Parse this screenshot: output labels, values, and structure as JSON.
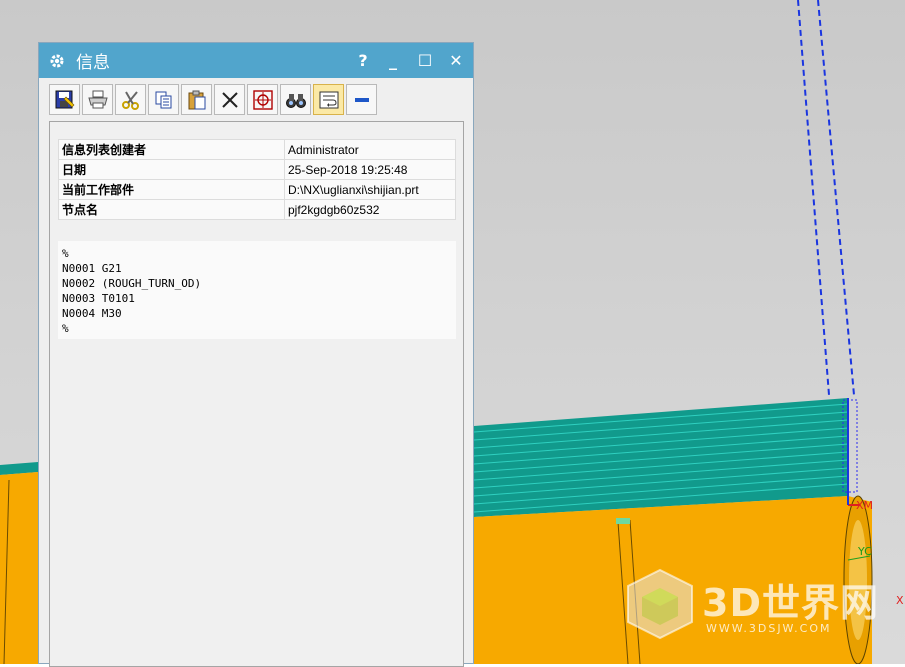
{
  "dialog": {
    "title": "信息",
    "help_label": "?",
    "minimize_label": "_",
    "maximize_label": "☐",
    "close_label": "✕"
  },
  "toolbar": {
    "tools": [
      {
        "icon": "save-icon"
      },
      {
        "icon": "print-icon"
      },
      {
        "icon": "cut-icon"
      },
      {
        "icon": "copy-icon"
      },
      {
        "icon": "paste-icon"
      },
      {
        "icon": "delete-icon"
      },
      {
        "icon": "target-icon"
      },
      {
        "icon": "binoculars-icon"
      },
      {
        "icon": "wrap-text-icon",
        "active": true
      },
      {
        "icon": "minimize-icon"
      }
    ]
  },
  "info": {
    "rows": [
      {
        "key": "信息列表创建者",
        "value": "Administrator"
      },
      {
        "key": "日期",
        "value": "25-Sep-2018 19:25:48"
      },
      {
        "key": "当前工作部件",
        "value": "D:\\NX\\uglianxi\\shijian.prt"
      },
      {
        "key": "节点名",
        "value": "pjf2kgdgb60z532"
      }
    ],
    "code_lines": [
      "%",
      "N0001 G21",
      "N0002 (ROUGH_TURN_OD)",
      "N0003 T0101",
      "N0004 M30",
      "%"
    ]
  },
  "viewport": {
    "axis_labels": {
      "xm": "XM",
      "yc": "YC",
      "x": "X"
    },
    "watermark_text": "3D世界网",
    "watermark_url": "WWW.3DSJW.COM"
  },
  "colors": {
    "titlebar": "#51a5cc",
    "part_orange": "#f7a900",
    "stock_teal": "#119a8c",
    "dash_blue": "#1a35e0"
  }
}
